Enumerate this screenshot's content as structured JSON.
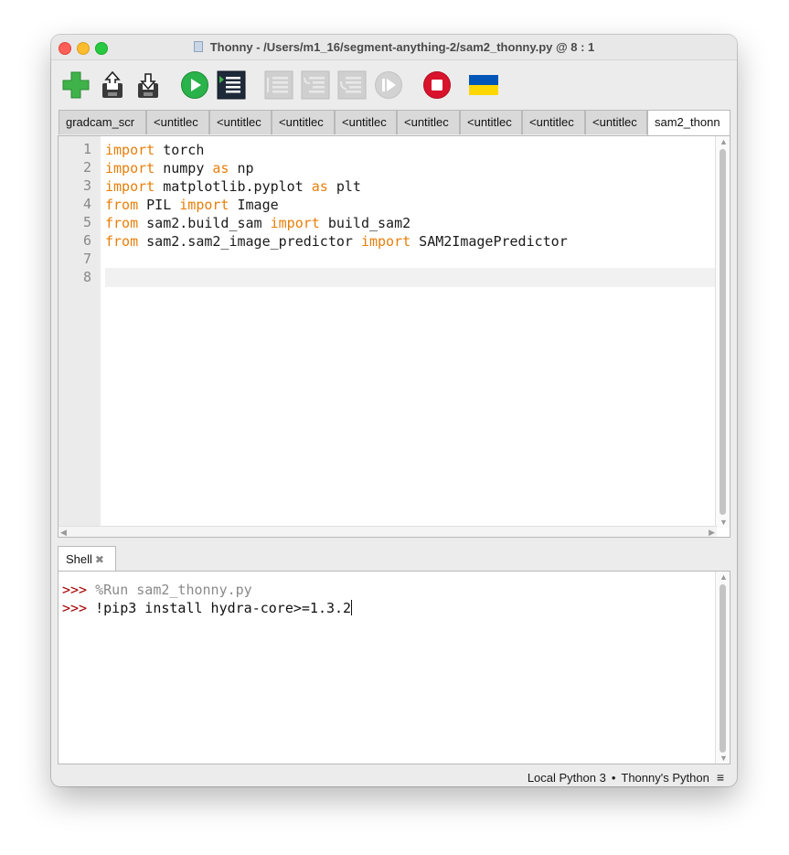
{
  "window": {
    "title": "Thonny  -  /Users/m1_16/segment-anything-2/sam2_thonny.py  @  8 : 1"
  },
  "toolbar": {
    "buttons": [
      {
        "name": "new-file",
        "icon": "plus-icon"
      },
      {
        "name": "open-file",
        "icon": "open-icon"
      },
      {
        "name": "save-file",
        "icon": "save-icon"
      },
      {
        "name": "run",
        "icon": "play-icon"
      },
      {
        "name": "debug",
        "icon": "debug-icon"
      },
      {
        "name": "step-over",
        "icon": "step-over-icon",
        "disabled": true
      },
      {
        "name": "step-into",
        "icon": "step-into-icon",
        "disabled": true
      },
      {
        "name": "step-out",
        "icon": "step-out-icon",
        "disabled": true
      },
      {
        "name": "resume",
        "icon": "resume-icon",
        "disabled": true
      },
      {
        "name": "stop",
        "icon": "stop-icon"
      },
      {
        "name": "support-ukraine",
        "icon": "ukraine-flag-icon"
      }
    ],
    "colors": {
      "run": "#29b34a",
      "stop": "#d9132b",
      "flag_blue": "#0057b7",
      "flag_yellow": "#ffd700"
    }
  },
  "tabs": [
    {
      "label": "gradcam_scr"
    },
    {
      "label": "<untitlec"
    },
    {
      "label": "<untitlec"
    },
    {
      "label": "<untitlec"
    },
    {
      "label": "<untitlec"
    },
    {
      "label": "<untitlec"
    },
    {
      "label": "<untitlec"
    },
    {
      "label": "<untitlec"
    },
    {
      "label": "<untitlec"
    },
    {
      "label": "sam2_thonn",
      "active": true
    }
  ],
  "editor": {
    "line_numbers": [
      "1",
      "2",
      "3",
      "4",
      "5",
      "6",
      "7",
      "8"
    ],
    "lines": [
      [
        {
          "t": "import",
          "kw": true
        },
        {
          "t": " torch"
        }
      ],
      [
        {
          "t": "import",
          "kw": true
        },
        {
          "t": " numpy "
        },
        {
          "t": "as",
          "kw": true
        },
        {
          "t": " np"
        }
      ],
      [
        {
          "t": "import",
          "kw": true
        },
        {
          "t": " matplotlib.pyplot "
        },
        {
          "t": "as",
          "kw": true
        },
        {
          "t": " plt"
        }
      ],
      [
        {
          "t": "from",
          "kw": true
        },
        {
          "t": " PIL "
        },
        {
          "t": "import",
          "kw": true
        },
        {
          "t": " Image"
        }
      ],
      [
        {
          "t": "from",
          "kw": true
        },
        {
          "t": " sam2.build_sam "
        },
        {
          "t": "import",
          "kw": true
        },
        {
          "t": " build_sam2"
        }
      ],
      [
        {
          "t": "from",
          "kw": true
        },
        {
          "t": " sam2.sam2_image_predictor "
        },
        {
          "t": "import",
          "kw": true
        },
        {
          "t": " SAM2ImagePredictor"
        }
      ],
      [],
      []
    ],
    "keyword_color": "#e87f0a"
  },
  "shell": {
    "tab_label": "Shell",
    "prompt": ">>>",
    "lines": [
      {
        "text": "%Run sam2_thonny.py",
        "style": "run"
      },
      {
        "text": "!pip3 install hydra-core>=1.3.2",
        "style": "cmd",
        "cursor": true
      }
    ]
  },
  "status": {
    "interpreter": "Local Python 3",
    "separator": "•",
    "env": "Thonny's Python",
    "menu_glyph": "≡"
  }
}
